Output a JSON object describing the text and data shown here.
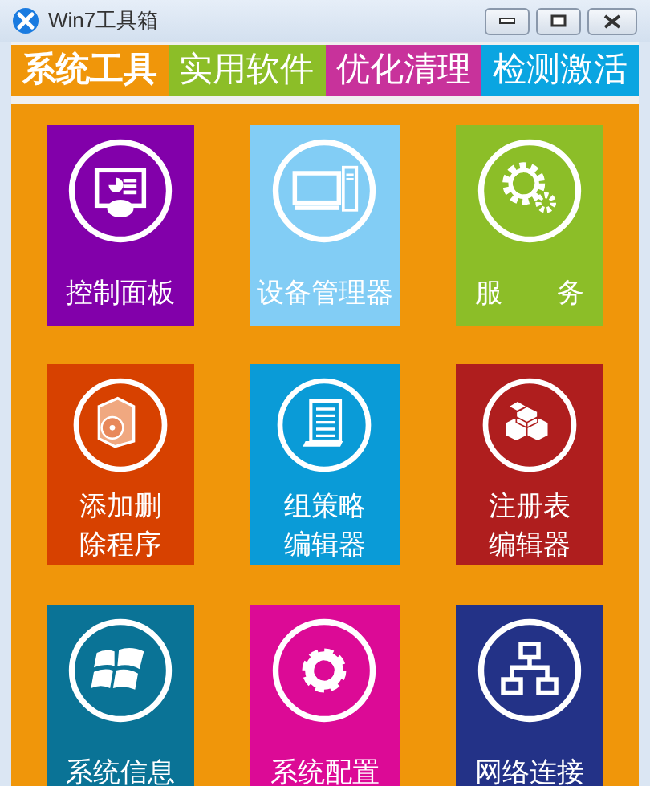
{
  "window": {
    "title": "Win7工具箱"
  },
  "tabs": [
    {
      "label": "系统工具",
      "selected": true,
      "color": "#f0960a"
    },
    {
      "label": "实用软件",
      "selected": false,
      "color": "#8cbe28"
    },
    {
      "label": "优化清理",
      "selected": false,
      "color": "#c8329b"
    },
    {
      "label": "检测激活",
      "selected": false,
      "color": "#0aa5e1"
    }
  ],
  "tiles": [
    {
      "label": "控制面板",
      "color": "#8200aa",
      "wrapped": false
    },
    {
      "label": "设备管理器",
      "color": "#82cdf5",
      "wrapped": false
    },
    {
      "label": "服　　务",
      "color": "#8cbe28",
      "wrapped": false
    },
    {
      "label": "添加删除程序",
      "color": "#d74100",
      "wrapped": true
    },
    {
      "label": "组策略编辑器",
      "color": "#0a9bd7",
      "wrapped": true
    },
    {
      "label": "注册表编辑器",
      "color": "#af1e1e",
      "wrapped": true
    },
    {
      "label": "系统信息",
      "color": "#0a7396",
      "wrapped": false
    },
    {
      "label": "系统配置",
      "color": "#dc0a96",
      "wrapped": false
    },
    {
      "label": "网络连接",
      "color": "#233287",
      "wrapped": false
    }
  ]
}
